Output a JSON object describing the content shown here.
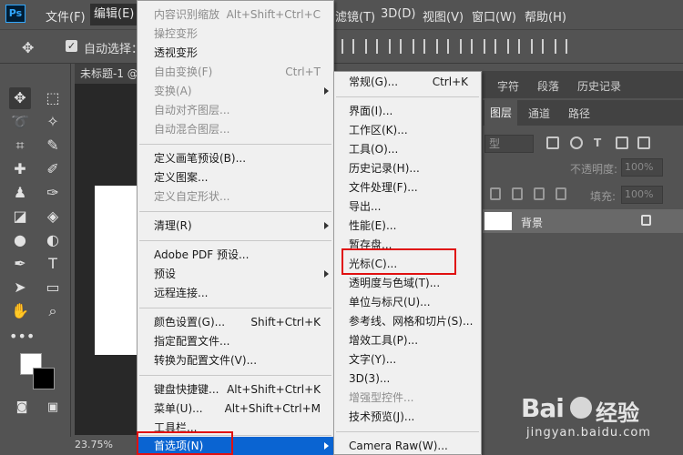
{
  "app": {
    "logo": "Ps",
    "menubar": [
      "文件(F)",
      "编辑(E)",
      "滤镜(T)",
      "3D(D)",
      "视图(V)",
      "窗口(W)",
      "帮助(H)"
    ]
  },
  "options": {
    "auto_select_label": "自动选择："
  },
  "document": {
    "tab_title": "未标题-1 @",
    "zoom": "23.75%"
  },
  "panels": {
    "top_tabs": [
      "字符",
      "段落",
      "历史记录"
    ],
    "layer_tabs": [
      "图层",
      "通道",
      "路径"
    ],
    "kind_placeholder": "型",
    "opacity_label": "不透明度:",
    "opacity_value": "100%",
    "fill_label": "填充:",
    "fill_value": "100%",
    "layer_name": "背景"
  },
  "edit_menu": {
    "items": [
      {
        "label": "内容识别缩放",
        "shortcut": "Alt+Shift+Ctrl+C",
        "disabled": true
      },
      {
        "label": "操控变形",
        "shortcut": "",
        "disabled": true
      },
      {
        "label": "透视变形",
        "shortcut": "",
        "disabled": false
      },
      {
        "label": "自由变换(F)",
        "shortcut": "Ctrl+T",
        "disabled": true
      },
      {
        "label": "变换(A)",
        "shortcut": "",
        "disabled": true,
        "submenu": true
      },
      {
        "label": "自动对齐图层...",
        "shortcut": "",
        "disabled": true
      },
      {
        "label": "自动混合图层...",
        "shortcut": "",
        "disabled": true
      },
      {
        "label": "定义画笔预设(B)...",
        "shortcut": "",
        "disabled": false
      },
      {
        "label": "定义图案...",
        "shortcut": "",
        "disabled": false
      },
      {
        "label": "定义自定形状...",
        "shortcut": "",
        "disabled": true
      },
      {
        "label": "清理(R)",
        "shortcut": "",
        "disabled": false,
        "submenu": true
      },
      {
        "label": "Adobe PDF 预设...",
        "shortcut": "",
        "disabled": false
      },
      {
        "label": "预设",
        "shortcut": "",
        "disabled": false,
        "submenu": true
      },
      {
        "label": "远程连接...",
        "shortcut": "",
        "disabled": false
      },
      {
        "label": "颜色设置(G)...",
        "shortcut": "Shift+Ctrl+K",
        "disabled": false
      },
      {
        "label": "指定配置文件...",
        "shortcut": "",
        "disabled": false
      },
      {
        "label": "转换为配置文件(V)...",
        "shortcut": "",
        "disabled": false
      },
      {
        "label": "键盘快捷键...",
        "shortcut": "Alt+Shift+Ctrl+K",
        "disabled": false
      },
      {
        "label": "菜单(U)...",
        "shortcut": "Alt+Shift+Ctrl+M",
        "disabled": false
      },
      {
        "label": "工具栏...",
        "shortcut": "",
        "disabled": false
      },
      {
        "label": "首选项(N)",
        "shortcut": "",
        "disabled": false,
        "submenu": true
      }
    ]
  },
  "preferences_menu": {
    "items": [
      {
        "label": "常规(G)...",
        "shortcut": "Ctrl+K",
        "disabled": false
      },
      {
        "label": "界面(I)...",
        "shortcut": "",
        "disabled": false
      },
      {
        "label": "工作区(K)...",
        "shortcut": "",
        "disabled": false
      },
      {
        "label": "工具(O)...",
        "shortcut": "",
        "disabled": false
      },
      {
        "label": "历史记录(H)...",
        "shortcut": "",
        "disabled": false
      },
      {
        "label": "文件处理(F)...",
        "shortcut": "",
        "disabled": false
      },
      {
        "label": "导出...",
        "shortcut": "",
        "disabled": false
      },
      {
        "label": "性能(E)...",
        "shortcut": "",
        "disabled": false
      },
      {
        "label": "暂存盘...",
        "shortcut": "",
        "disabled": false
      },
      {
        "label": "光标(C)...",
        "shortcut": "",
        "disabled": false
      },
      {
        "label": "透明度与色域(T)...",
        "shortcut": "",
        "disabled": false
      },
      {
        "label": "单位与标尺(U)...",
        "shortcut": "",
        "disabled": false
      },
      {
        "label": "参考线、网格和切片(S)...",
        "shortcut": "",
        "disabled": false
      },
      {
        "label": "增效工具(P)...",
        "shortcut": "",
        "disabled": false
      },
      {
        "label": "文字(Y)...",
        "shortcut": "",
        "disabled": false
      },
      {
        "label": "3D(3)...",
        "shortcut": "",
        "disabled": false
      },
      {
        "label": "增强型控件...",
        "shortcut": "",
        "disabled": true
      },
      {
        "label": "技术预览(J)...",
        "shortcut": "",
        "disabled": false
      },
      {
        "label": "Camera Raw(W)...",
        "shortcut": "",
        "disabled": false
      }
    ]
  },
  "watermark": {
    "logo": "Bai",
    "name": "经验",
    "url": "jingyan.baidu.com"
  },
  "colors": {
    "highlight": "#0a64d2",
    "annotation": "#e01010",
    "menu_bg": "#f0f0f0",
    "ui_bg": "#535353"
  }
}
